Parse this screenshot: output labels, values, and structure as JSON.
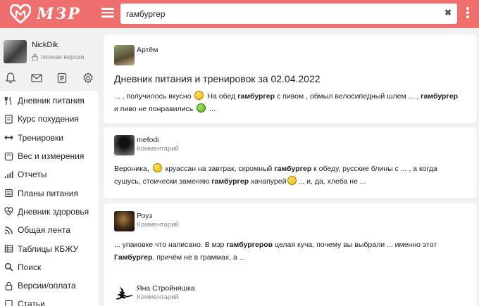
{
  "header": {
    "logo_text": "МЗР",
    "search_value": "гамбургер",
    "clear_icon": "✖"
  },
  "user": {
    "name": "NickDik",
    "status": "полная версия"
  },
  "nav": [
    {
      "label": "Дневник питания",
      "icon": "diary-icon"
    },
    {
      "label": "Курс похудения",
      "icon": "course-icon"
    },
    {
      "label": "Тренировки",
      "icon": "workout-icon"
    },
    {
      "label": "Вес и измерения",
      "icon": "scale-icon"
    },
    {
      "label": "Отчеты",
      "icon": "chart-icon"
    },
    {
      "label": "Планы питания",
      "icon": "plan-icon"
    },
    {
      "label": "Дневник здоровья",
      "icon": "health-icon"
    },
    {
      "label": "Общая лента",
      "icon": "feed-icon"
    },
    {
      "label": "Таблицы КБЖУ",
      "icon": "table-icon"
    },
    {
      "label": "Поиск",
      "icon": "search-icon"
    },
    {
      "label": "Версии/оплата",
      "icon": "lock-icon"
    },
    {
      "label": "Статьи",
      "icon": "article-icon"
    }
  ],
  "cards": [
    {
      "author": "Артём",
      "subtitle": "",
      "title": "Дневник питания и тренировок за 02.04.2022",
      "text_parts": [
        "... , получилось вкусно ",
        "  На обед ",
        "гамбургер",
        " с пивом , обмыл велосипедный шлем ... , ",
        "гамбургер",
        "и пиво не понравились ",
        " ..."
      ]
    },
    {
      "author": "mefodi",
      "subtitle": "Комментарий",
      "text_parts": [
        "Вероника, ",
        " круассан на завтрак, скромный ",
        "гамбургер",
        " к обеду, русские блины с ... , а когда",
        "сушусь, стоически заменяю ",
        "гамбургер",
        " хачапурей",
        "... и, да, хлеба не ..."
      ]
    },
    {
      "author": "Роуз",
      "subtitle": "Комментарий",
      "text_parts": [
        "... упаковке что написано. В мзр ",
        "гамбургеров",
        " целая куча, почему вы выбрали ... именно этот",
        "Гамбургер",
        ", причём не в граммах, а ..."
      ]
    },
    {
      "author": "Яна Стройняшка",
      "subtitle": "Комментарий"
    }
  ]
}
